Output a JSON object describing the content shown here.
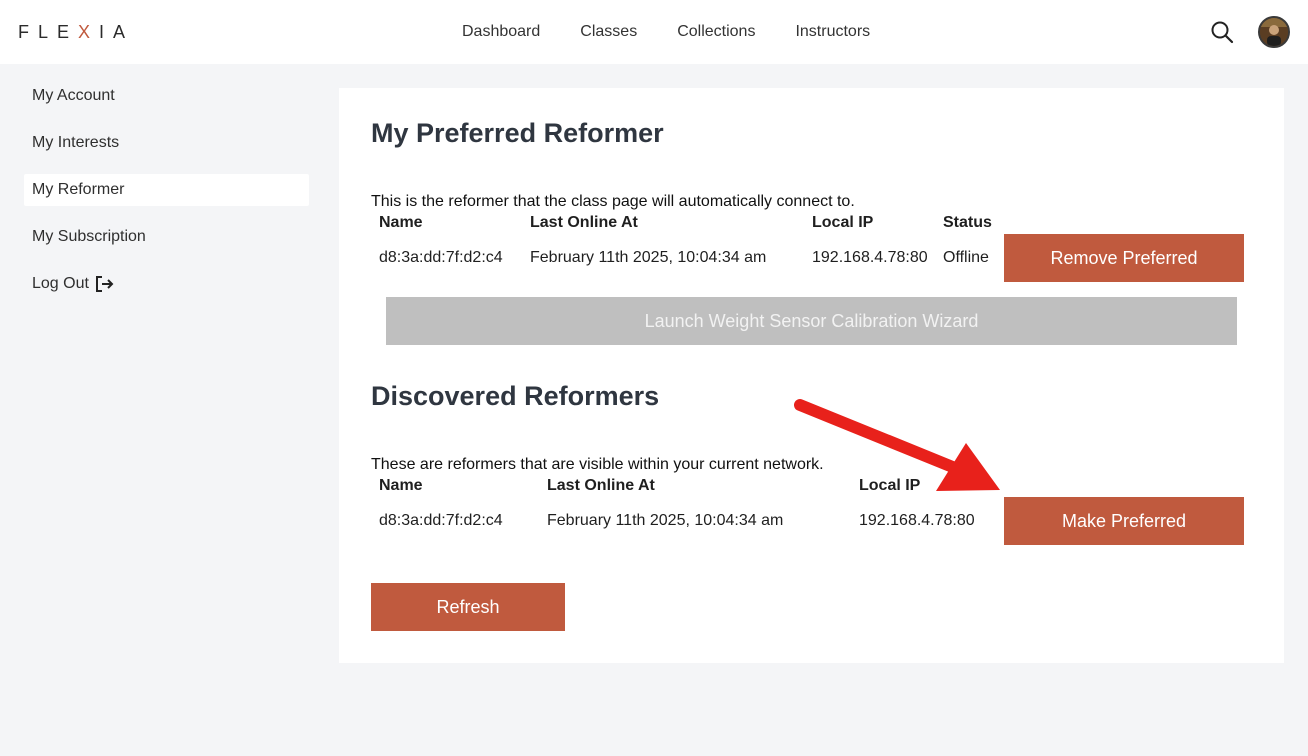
{
  "brand": {
    "logo_left": "FLE",
    "logo_x": "X",
    "logo_right": "IA"
  },
  "nav": {
    "items": [
      {
        "label": "Dashboard"
      },
      {
        "label": "Classes"
      },
      {
        "label": "Collections"
      },
      {
        "label": "Instructors"
      }
    ]
  },
  "sidebar": {
    "items": [
      {
        "label": "My Account"
      },
      {
        "label": "My Interests"
      },
      {
        "label": "My Reformer"
      },
      {
        "label": "My Subscription"
      },
      {
        "label": "Log Out"
      }
    ],
    "active": "My Reformer"
  },
  "preferred": {
    "title": "My Preferred Reformer",
    "description": "This is the reformer that the class page will automatically connect to.",
    "columns": {
      "name": "Name",
      "last_online": "Last Online At",
      "local_ip": "Local IP",
      "status": "Status"
    },
    "row": {
      "name": "d8:3a:dd:7f:d2:c4",
      "last_online": "February 11th 2025, 10:04:34 am",
      "local_ip": "192.168.4.78:80",
      "status": "Offline"
    },
    "remove_label": "Remove Preferred",
    "wizard_label": "Launch Weight Sensor Calibration Wizard"
  },
  "discovered": {
    "title": "Discovered Reformers",
    "description": "These are reformers that are visible within your current network.",
    "columns": {
      "name": "Name",
      "last_online": "Last Online At",
      "local_ip": "Local IP"
    },
    "row": {
      "name": "d8:3a:dd:7f:d2:c4",
      "last_online": "February 11th 2025, 10:04:34 am",
      "local_ip": "192.168.4.78:80"
    },
    "make_label": "Make Preferred",
    "refresh_label": "Refresh"
  },
  "colors": {
    "accent": "#c05a3e",
    "disabled": "#bfbfbf",
    "annotation": "#e8211b",
    "background": "#f4f5f7"
  },
  "icons": {
    "search": "search-icon",
    "logout": "logout-icon",
    "avatar": "user-avatar"
  }
}
